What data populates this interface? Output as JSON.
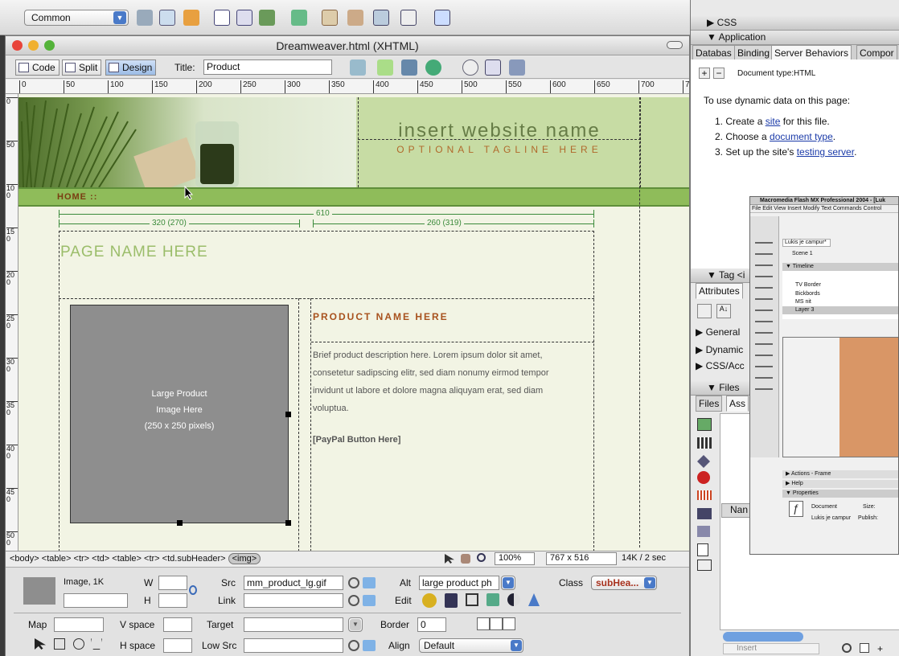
{
  "insert_bar": {
    "category": "Common"
  },
  "window": {
    "title": "Dreamweaver.html (XHTML)"
  },
  "doc_toolbar": {
    "code": "Code",
    "split": "Split",
    "design": "Design",
    "title_label": "Title:",
    "title_value": "Product"
  },
  "ruler": {
    "marks": [
      "0",
      "50",
      "100",
      "150",
      "200",
      "250",
      "300",
      "350",
      "400",
      "450",
      "500",
      "550",
      "600",
      "650",
      "700",
      "750"
    ],
    "vmarks": [
      "0",
      "50",
      "100",
      "150",
      "200",
      "250",
      "300",
      "350",
      "400",
      "450",
      "500"
    ]
  },
  "page": {
    "site_name": "insert website name",
    "tagline": "OPTIONAL TAGLINE HERE",
    "nav_home": "HOME  ::",
    "measure_total": "610",
    "measure_left": "320 (270)",
    "measure_right": "260 (319)",
    "page_name": "PAGE NAME HERE",
    "image_placeholder": [
      "Large Product",
      "Image Here",
      "(250 x 250 pixels)"
    ],
    "product_name": "PRODUCT NAME HERE",
    "description": "Brief product description here. Lorem ipsum dolor sit amet, consetetur sadipscing elitr, sed diam nonumy eirmod tempor invidunt ut labore et dolore magna aliquyam erat, sed diam voluptua.",
    "paypal": "[PayPal Button Here]"
  },
  "status": {
    "tags": [
      "<body>",
      "<table>",
      "<tr>",
      "<td>",
      "<table>",
      "<tr>",
      "<td.subHeader>"
    ],
    "current_tag": "<img>",
    "zoom": "100%",
    "size": "767 x 516",
    "weight": "14K / 2 sec"
  },
  "properties": {
    "type": "Image, 1K",
    "w_label": "W",
    "h_label": "H",
    "src_label": "Src",
    "src_value": "mm_product_lg.gif",
    "link_label": "Link",
    "alt_label": "Alt",
    "alt_value": "large product ph",
    "edit_label": "Edit",
    "class_label": "Class",
    "class_value": "subHea...",
    "map_label": "Map",
    "vspace_label": "V space",
    "hspace_label": "H space",
    "target_label": "Target",
    "lowsrc_label": "Low Src",
    "border_label": "Border",
    "border_value": "0",
    "align_label": "Align",
    "align_value": "Default"
  },
  "panels": {
    "css": "CSS",
    "application": "Application",
    "app_tabs": [
      "Databas",
      "Binding",
      "Server Behaviors",
      "Compor"
    ],
    "doc_type": "Document type:HTML",
    "intro": "To use dynamic data on this page:",
    "steps": [
      {
        "pre": "1. Create a ",
        "link": "site",
        "post": " for this file."
      },
      {
        "pre": "2. Choose a ",
        "link": "document type",
        "post": "."
      },
      {
        "pre": "3. Set up the site's ",
        "link": "testing server",
        "post": "."
      }
    ],
    "tag_inspector": "Tag <i",
    "attributes_tab": "Attributes",
    "tag_groups": [
      "General",
      "Dynamic",
      "CSS/Acc"
    ],
    "files": "Files",
    "files_tabs": [
      "Files",
      "Ass"
    ],
    "name_col": "Nan",
    "insert_btn": "Insert"
  },
  "flash_window": {
    "title": "Macromedia Flash MX Professional 2004 - [Luk",
    "menu": "File  Edit  View  Insert  Modify  Text  Commands  Control",
    "tab": "Lukis je campur*",
    "scene": "Scene 1",
    "timeline": "Timeline",
    "layers": [
      "TV Border",
      "Bickbords",
      "MS nit",
      "Layer 3"
    ],
    "actions": "Actions - Frame",
    "help": "Help",
    "properties": "Properties",
    "doc_label": "Document",
    "doc_name": "Lukis je campur",
    "size_label": "Size:",
    "publish_label": "Publish:"
  }
}
